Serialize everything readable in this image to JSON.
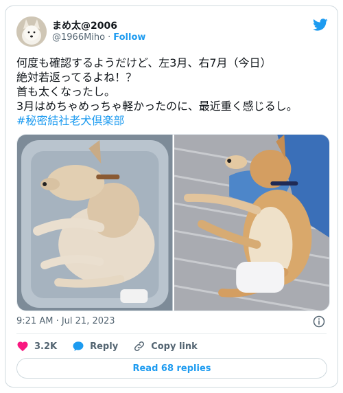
{
  "tweet": {
    "display_name": "まめ太@2006",
    "handle": "@1966Miho",
    "separator": "·",
    "follow_label": "Follow",
    "text_lines": [
      "何度も確認するようだけど、左3月、右7月（今日）",
      "絶対若返ってるよね！？",
      "首も太くなったし。",
      "3月はめちゃめっちゃ軽かったのに、最近重く感じるし。"
    ],
    "hashtag": "#秘密結社老犬倶楽部",
    "timestamp": "9:21 AM · Jul 21, 2023",
    "actions": {
      "like_count": "3.2K",
      "reply_label": "Reply",
      "copy_link_label": "Copy link"
    },
    "read_replies_label": "Read 68 replies"
  },
  "colors": {
    "brand_blue": "#1d9bf0",
    "like_red": "#f91880",
    "muted": "#536471"
  },
  "icons": {
    "logo": "twitter-bird-icon",
    "info": "info-icon",
    "like": "heart-icon",
    "reply": "speech-bubble-icon",
    "copy": "link-icon"
  }
}
